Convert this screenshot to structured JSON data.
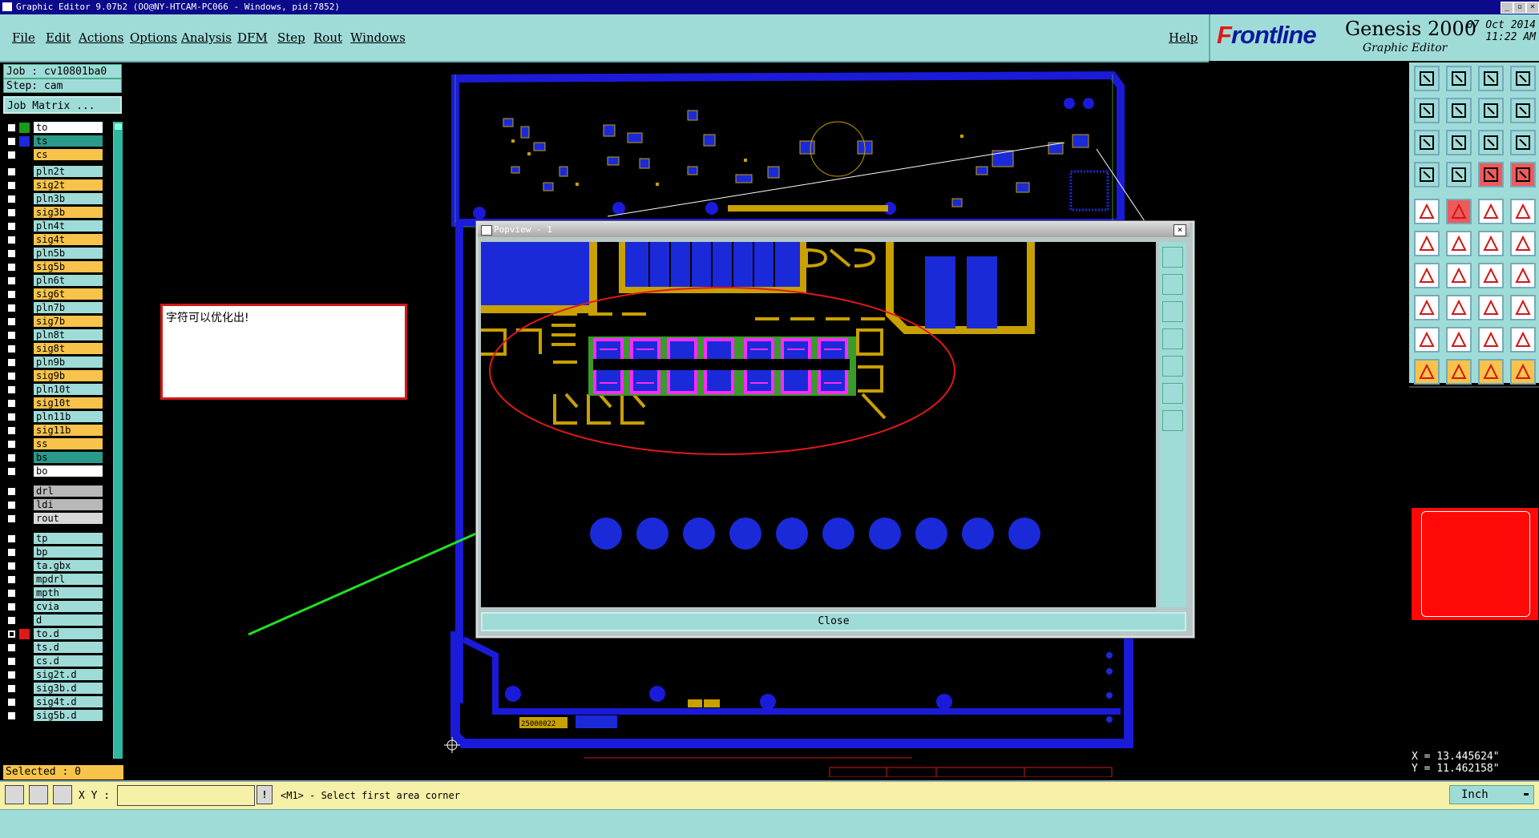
{
  "window": {
    "title": "Graphic Editor 9.07b2 (OO@NY-HTCAM-PC066 - Windows, pid:7852)"
  },
  "menu": [
    "File",
    "Edit",
    "Actions",
    "Options",
    "Analysis",
    "DFM",
    "Step",
    "Rout",
    "Windows"
  ],
  "help": "Help",
  "brand": {
    "logo_rest": "rontline",
    "logo_f": "F",
    "product": "Genesis 2000",
    "subtitle": "Graphic Editor",
    "date": "07 Oct 2014",
    "time": "11:22 AM"
  },
  "job": {
    "job_label": "Job : cv10801ba0",
    "step_label": "Step: cam",
    "matrix_button": "Job Matrix ..."
  },
  "layers": [
    {
      "name": "to",
      "color": "#fff",
      "swatch": "#1a9a1a"
    },
    {
      "name": "ts",
      "color": "#2a9a8a",
      "swatch": "#1a2ad8"
    },
    {
      "name": "cs",
      "color": "#f7c34a",
      "swatch": ""
    },
    {
      "name": "pln2t",
      "color": "#9fdcd8",
      "swatch": ""
    },
    {
      "name": "sig2t",
      "color": "#f7c34a",
      "swatch": ""
    },
    {
      "name": "pln3b",
      "color": "#9fdcd8",
      "swatch": ""
    },
    {
      "name": "sig3b",
      "color": "#f7c34a",
      "swatch": ""
    },
    {
      "name": "pln4t",
      "color": "#9fdcd8",
      "swatch": ""
    },
    {
      "name": "sig4t",
      "color": "#f7c34a",
      "swatch": ""
    },
    {
      "name": "pln5b",
      "color": "#9fdcd8",
      "swatch": ""
    },
    {
      "name": "sig5b",
      "color": "#f7c34a",
      "swatch": ""
    },
    {
      "name": "pln6t",
      "color": "#9fdcd8",
      "swatch": ""
    },
    {
      "name": "sig6t",
      "color": "#f7c34a",
      "swatch": ""
    },
    {
      "name": "pln7b",
      "color": "#9fdcd8",
      "swatch": ""
    },
    {
      "name": "sig7b",
      "color": "#f7c34a",
      "swatch": ""
    },
    {
      "name": "pln8t",
      "color": "#9fdcd8",
      "swatch": ""
    },
    {
      "name": "sig8t",
      "color": "#f7c34a",
      "swatch": ""
    },
    {
      "name": "pln9b",
      "color": "#9fdcd8",
      "swatch": ""
    },
    {
      "name": "sig9b",
      "color": "#f7c34a",
      "swatch": ""
    },
    {
      "name": "pln10t",
      "color": "#9fdcd8",
      "swatch": ""
    },
    {
      "name": "sig10t",
      "color": "#f7c34a",
      "swatch": ""
    },
    {
      "name": "pln11b",
      "color": "#9fdcd8",
      "swatch": ""
    },
    {
      "name": "sig11b",
      "color": "#f7c34a",
      "swatch": ""
    },
    {
      "name": "ss",
      "color": "#f7c34a",
      "swatch": ""
    },
    {
      "name": "bs",
      "color": "#2a9a8a",
      "swatch": ""
    },
    {
      "name": "bo",
      "color": "#fff",
      "swatch": ""
    },
    {
      "name": "drl",
      "color": "#b8b8b8",
      "swatch": ""
    },
    {
      "name": "ldi",
      "color": "#b8b8b8",
      "swatch": ""
    },
    {
      "name": "rout",
      "color": "#d8d8d8",
      "swatch": ""
    },
    {
      "name": "tp",
      "color": "#9fdcd8",
      "swatch": ""
    },
    {
      "name": "bp",
      "color": "#9fdcd8",
      "swatch": ""
    },
    {
      "name": "ta.gbx",
      "color": "#9fdcd8",
      "swatch": ""
    },
    {
      "name": "mpdrl",
      "color": "#9fdcd8",
      "swatch": ""
    },
    {
      "name": "mpth",
      "color": "#9fdcd8",
      "swatch": ""
    },
    {
      "name": "cvia",
      "color": "#9fdcd8",
      "swatch": ""
    },
    {
      "name": "d",
      "color": "#9fdcd8",
      "swatch": ""
    },
    {
      "name": "to.d",
      "color": "#9fdcd8",
      "swatch": "#e01818"
    },
    {
      "name": "ts.d",
      "color": "#9fdcd8",
      "swatch": ""
    },
    {
      "name": "cs.d",
      "color": "#9fdcd8",
      "swatch": ""
    },
    {
      "name": "sig2t.d",
      "color": "#9fdcd8",
      "swatch": ""
    },
    {
      "name": "sig3b.d",
      "color": "#9fdcd8",
      "swatch": ""
    },
    {
      "name": "sig4t.d",
      "color": "#9fdcd8",
      "swatch": ""
    },
    {
      "name": "sig5b.d",
      "color": "#9fdcd8",
      "swatch": ""
    }
  ],
  "selected_label": "Selected : 0",
  "note": {
    "text": "字符可以优化出!"
  },
  "popup": {
    "title": "Popview - 1",
    "close": "Close"
  },
  "board_labels": {
    "part_no": "25000022"
  },
  "coords": {
    "x": "X = 13.445624\"",
    "y": "Y = 11.462158\""
  },
  "status": {
    "xy_label": "X Y :",
    "xy_value": "",
    "message": "<M1> - Select first area corner",
    "units": "Inch"
  },
  "colors": {
    "panel": "#9fdcd8",
    "copper": "#1a2ad8",
    "silk": "#c8a000",
    "highlight": "#ff2aff"
  }
}
